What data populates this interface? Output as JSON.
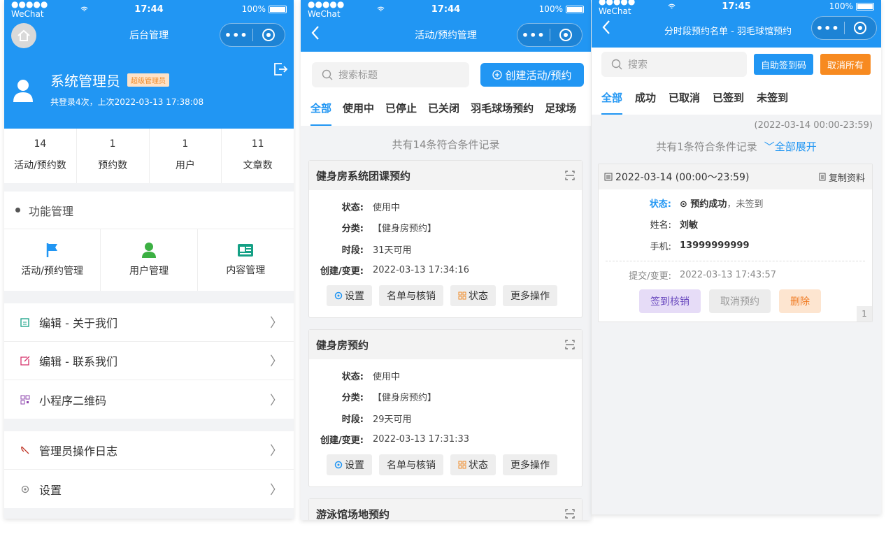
{
  "colors": {
    "primary": "#2196f3",
    "orange": "#f78a20",
    "badge": "#f08c2a"
  },
  "statusbar": {
    "p1": {
      "carrier": "●●●●● WeChat",
      "time": "17:44",
      "battery": "100%"
    },
    "p2": {
      "carrier": "●●●●● WeChat",
      "time": "17:44",
      "battery": "100%"
    },
    "p3": {
      "carrier": "●●●●● WeChat",
      "time": "17:45",
      "battery": "100%"
    }
  },
  "p1": {
    "title": "后台管理",
    "admin": {
      "name": "系统管理员",
      "badge": "超级管理员",
      "sub": "共登录4次，上次2022-03-13 17:38:08"
    },
    "stats": [
      {
        "num": "14",
        "label": "活动/预约数"
      },
      {
        "num": "1",
        "label": "预约数"
      },
      {
        "num": "1",
        "label": "用户"
      },
      {
        "num": "11",
        "label": "文章数"
      }
    ],
    "section_title": "功能管理",
    "funcs": [
      {
        "label": "活动/预约管理",
        "icon": "flag-icon"
      },
      {
        "label": "用户管理",
        "icon": "user-icon"
      },
      {
        "label": "内容管理",
        "icon": "id-card-icon"
      }
    ],
    "menu1": [
      {
        "label": "编辑 - 关于我们",
        "icon": "edit-icon"
      },
      {
        "label": "编辑 - 联系我们",
        "icon": "edit-icon"
      },
      {
        "label": "小程序二维码",
        "icon": "qrcode-icon"
      }
    ],
    "menu2": [
      {
        "label": "管理员操作日志",
        "icon": "log-icon"
      },
      {
        "label": "设置",
        "icon": "gear-icon"
      }
    ]
  },
  "p2": {
    "title": "活动/预约管理",
    "search_placeholder": "搜索标题",
    "create_label": "创建活动/预约",
    "tabs": [
      "全部",
      "使用中",
      "已停止",
      "已关闭",
      "羽毛球场预约",
      "足球场"
    ],
    "count": "共有14条符合条件记录",
    "labels": {
      "status": "状态:",
      "category": "分类:",
      "period": "时段:",
      "created": "创建/变更:"
    },
    "ops": [
      "设置",
      "名单与核销",
      "状态",
      "更多操作"
    ],
    "cards": [
      {
        "title": "健身房系统团课预约",
        "status": "使用中",
        "category": "【健身房预约】",
        "period": "31天可用",
        "created": "2022-03-13 17:34:16"
      },
      {
        "title": "健身房预约",
        "status": "使用中",
        "category": "【健身房预约】",
        "period": "29天可用",
        "created": "2022-03-13 17:31:33"
      },
      {
        "title": "游泳馆场地预约"
      }
    ]
  },
  "p3": {
    "title": "分时段预约名单 - 羽毛球馆预约",
    "search_placeholder": "搜索",
    "sign_btn": "自助签到码",
    "cancel_all_btn": "取消所有",
    "tabs": [
      "全部",
      "成功",
      "已取消",
      "已签到",
      "未签到"
    ],
    "daterange": "(2022-03-14 00:00-23:59)",
    "count": "共有1条符合条件记录",
    "expand": "全部展开",
    "record": {
      "date": "2022-03-14 (00:00～23:59)",
      "copy": "复制资料",
      "status_label": "状态:",
      "status_ok": "预约成功",
      "status_rest": "，未签到",
      "name_label": "姓名:",
      "name": "刘敏",
      "phone_label": "手机:",
      "phone": "13999999999",
      "submit_label": "提交/变更:",
      "submit": "2022-03-13 17:43:57",
      "btn_sign": "签到核销",
      "btn_cancel": "取消预约",
      "btn_delete": "删除",
      "page": "1"
    }
  }
}
